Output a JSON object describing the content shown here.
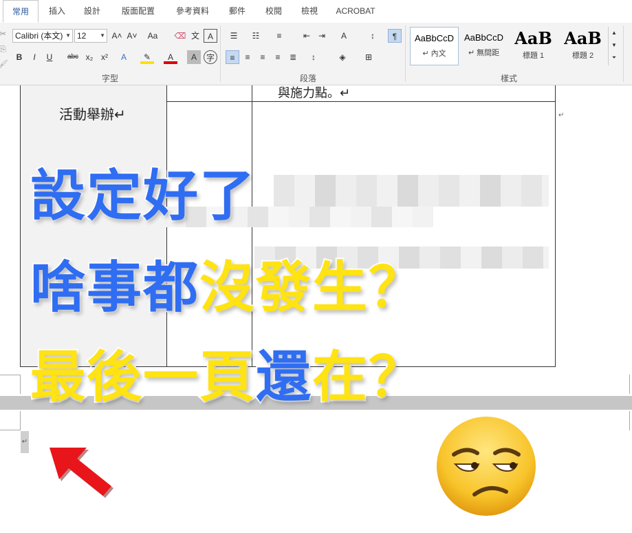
{
  "tabs": [
    "常用",
    "插入",
    "設計",
    "版面配置",
    "參考資料",
    "郵件",
    "校閱",
    "檢視",
    "ACROBAT"
  ],
  "ribbon": {
    "font_name": "Calibri (本文)",
    "font_size": "12",
    "group_font": "字型",
    "group_paragraph": "段落",
    "group_styles": "樣式",
    "styles": [
      {
        "sample": "AaBbCcD",
        "name": "↵ 內文"
      },
      {
        "sample": "AaBbCcD",
        "name": "↵ 無間距"
      },
      {
        "sample": "AaB",
        "name": "標題 1"
      },
      {
        "sample": "AaB",
        "name": "標題 2"
      }
    ],
    "btn_grow": "A˄",
    "btn_shrink": "A˅",
    "btn_case": "Aa",
    "btn_bold": "B",
    "btn_italic": "I",
    "btn_underline": "U",
    "btn_strike": "abc",
    "btn_sub": "x₂",
    "btn_sup": "x²"
  },
  "document": {
    "cell_top_text": "與施力點。↵",
    "cell_left_text": "活動舉辦↵",
    "para_mark": "↵"
  },
  "overlay": {
    "line1": "設定好了",
    "line2_blue": "啥事都",
    "line2_yellow": "沒發生？",
    "line3_yellow1": "最後",
    "line3_blue1": "一頁",
    "line3_blue2": "還",
    "line3_yellow2": "在？"
  },
  "colors": {
    "blue": "#2f6df2",
    "yellow": "#ffe312",
    "arrow": "#e8151b",
    "ribbon_accent": "#2b579a"
  },
  "icons": [
    "red-arrow-icon",
    "unamused-face-emoji"
  ]
}
